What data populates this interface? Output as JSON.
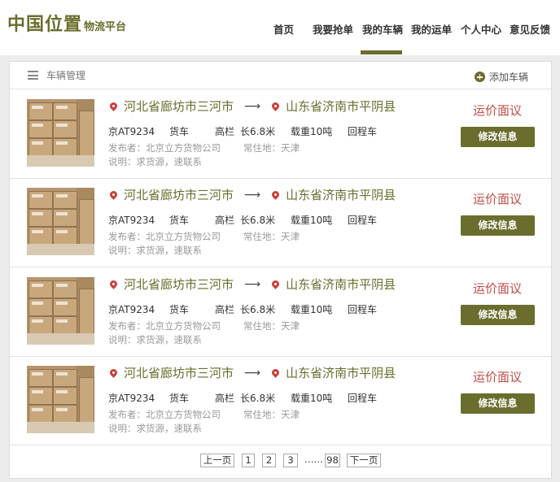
{
  "logo": {
    "main": "中国位置",
    "sub": "物流平台"
  },
  "nav": {
    "items": [
      {
        "label": "首页"
      },
      {
        "label": "我要抢单"
      },
      {
        "label": "我的车辆"
      },
      {
        "label": "我的运单"
      },
      {
        "label": "个人中心"
      },
      {
        "label": "意见反馈"
      }
    ],
    "active": "我的车辆"
  },
  "panel": {
    "title": "车辆管理",
    "add_label": "添加车辆"
  },
  "vehicles": [
    {
      "from": "河北省廊坊市三河市",
      "to": "山东省济南市平阴县",
      "plate": "京AT9234",
      "type": "货车",
      "body": "高栏",
      "length": "长6.8米",
      "load": "载重10吨",
      "trip": "回程车",
      "publisher": "发布者：北京立方货物公司",
      "residence": "常住地：天津",
      "note": "说明：求货源，速联系",
      "price": "运价面议",
      "edit_label": "修改信息"
    },
    {
      "from": "河北省廊坊市三河市",
      "to": "山东省济南市平阴县",
      "plate": "京AT9234",
      "type": "货车",
      "body": "高栏",
      "length": "长6.8米",
      "load": "载重10吨",
      "trip": "回程车",
      "publisher": "发布者：北京立方货物公司",
      "residence": "常住地：天津",
      "note": "说明：求货源，速联系",
      "price": "运价面议",
      "edit_label": "修改信息"
    },
    {
      "from": "河北省廊坊市三河市",
      "to": "山东省济南市平阴县",
      "plate": "京AT9234",
      "type": "货车",
      "body": "高栏",
      "length": "长6.8米",
      "load": "载重10吨",
      "trip": "回程车",
      "publisher": "发布者：北京立方货物公司",
      "residence": "常住地：天津",
      "note": "说明：求货源，速联系",
      "price": "运价面议",
      "edit_label": "修改信息"
    },
    {
      "from": "河北省廊坊市三河市",
      "to": "山东省济南市平阴县",
      "plate": "京AT9234",
      "type": "货车",
      "body": "高栏",
      "length": "长6.8米",
      "load": "载重10吨",
      "trip": "回程车",
      "publisher": "发布者：北京立方货物公司",
      "residence": "常住地：天津",
      "note": "说明：求货源，速联系",
      "price": "运价面议",
      "edit_label": "修改信息"
    }
  ],
  "pagination": {
    "prev": "上一页",
    "pages": [
      "1",
      "2",
      "3"
    ],
    "ellipsis": "……",
    "last": "98",
    "next": "下一页"
  },
  "colors": {
    "brand": "#6b6d2e",
    "price": "#c24d45",
    "pin": "#c9403a"
  }
}
